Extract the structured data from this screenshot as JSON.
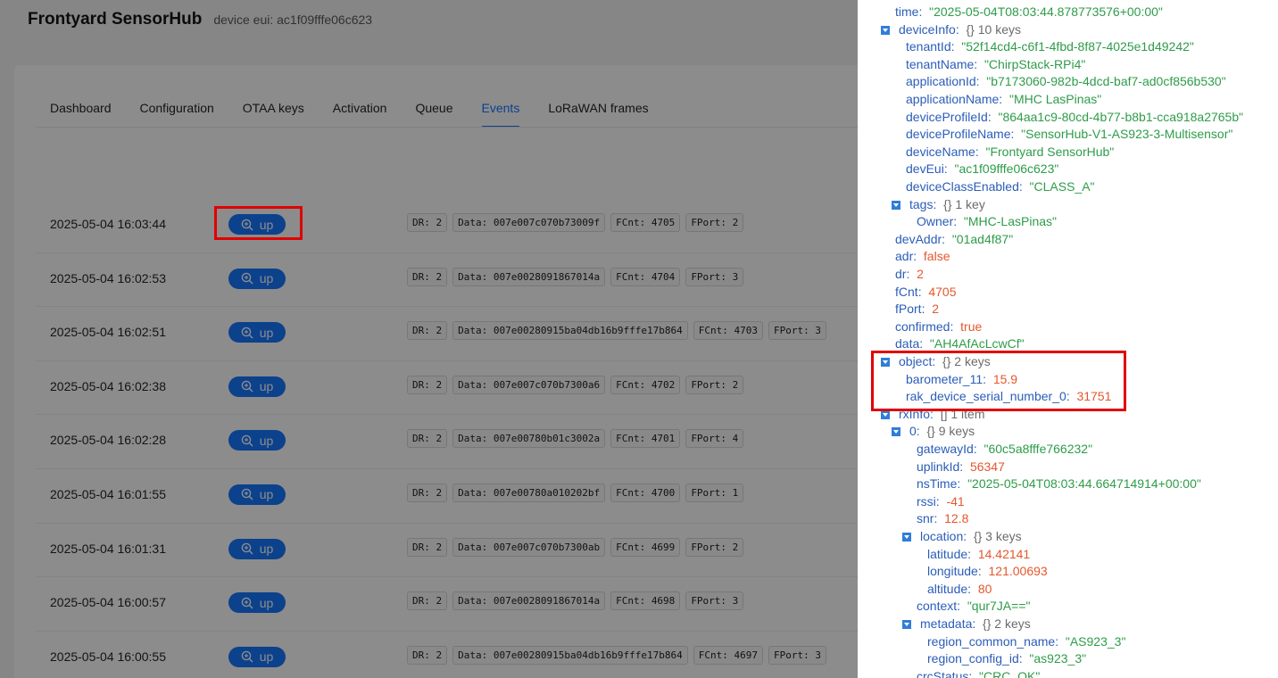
{
  "header": {
    "title": "Frontyard SensorHub",
    "subtitle": "device eui: ac1f09fffe06c623"
  },
  "tabs": [
    {
      "label": "Dashboard"
    },
    {
      "label": "Configuration"
    },
    {
      "label": "OTAA keys"
    },
    {
      "label": "Activation"
    },
    {
      "label": "Queue"
    },
    {
      "label": "Events",
      "active": true
    },
    {
      "label": "LoRaWAN frames"
    }
  ],
  "events": [
    {
      "time": "2025-05-04 16:03:44",
      "type": "up",
      "dr": "DR: 2",
      "data": "Data: 007e007c070b73009f",
      "fcnt": "FCnt: 4705",
      "fport": "FPort: 2"
    },
    {
      "time": "2025-05-04 16:02:53",
      "type": "up",
      "dr": "DR: 2",
      "data": "Data: 007e0028091867014a",
      "fcnt": "FCnt: 4704",
      "fport": "FPort: 3"
    },
    {
      "time": "2025-05-04 16:02:51",
      "type": "up",
      "dr": "DR: 2",
      "data": "Data: 007e00280915ba04db16b9fffe17b864",
      "fcnt": "FCnt: 4703",
      "fport": "FPort: 3"
    },
    {
      "time": "2025-05-04 16:02:38",
      "type": "up",
      "dr": "DR: 2",
      "data": "Data: 007e007c070b7300a6",
      "fcnt": "FCnt: 4702",
      "fport": "FPort: 2"
    },
    {
      "time": "2025-05-04 16:02:28",
      "type": "up",
      "dr": "DR: 2",
      "data": "Data: 007e00780b01c3002a",
      "fcnt": "FCnt: 4701",
      "fport": "FPort: 4"
    },
    {
      "time": "2025-05-04 16:01:55",
      "type": "up",
      "dr": "DR: 2",
      "data": "Data: 007e00780a010202bf",
      "fcnt": "FCnt: 4700",
      "fport": "FPort: 1"
    },
    {
      "time": "2025-05-04 16:01:31",
      "type": "up",
      "dr": "DR: 2",
      "data": "Data: 007e007c070b7300ab",
      "fcnt": "FCnt: 4699",
      "fport": "FPort: 2"
    },
    {
      "time": "2025-05-04 16:00:57",
      "type": "up",
      "dr": "DR: 2",
      "data": "Data: 007e0028091867014a",
      "fcnt": "FCnt: 4698",
      "fport": "FPort: 3"
    },
    {
      "time": "2025-05-04 16:00:55",
      "type": "up",
      "dr": "DR: 2",
      "data": "Data: 007e00280915ba04db16b9fffe17b864",
      "fcnt": "FCnt: 4697",
      "fport": "FPort: 3"
    }
  ],
  "json_tree": [
    {
      "key": "time",
      "value": "\"2025-05-04T08:03:44.878773576+00:00\"",
      "kind": "str",
      "indent": 0,
      "toggle": false
    },
    {
      "key": "deviceInfo",
      "meta": "{}  10 keys",
      "indent": 0,
      "toggle": true
    },
    {
      "key": "tenantId",
      "value": "\"52f14cd4-c6f1-4fbd-8f87-4025e1d49242\"",
      "kind": "str",
      "indent": 1
    },
    {
      "key": "tenantName",
      "value": "\"ChirpStack-RPi4\"",
      "kind": "str",
      "indent": 1
    },
    {
      "key": "applicationId",
      "value": "\"b7173060-982b-4dcd-baf7-ad0cf856b530\"",
      "kind": "str",
      "indent": 1
    },
    {
      "key": "applicationName",
      "value": "\"MHC LasPinas\"",
      "kind": "str",
      "indent": 1
    },
    {
      "key": "deviceProfileId",
      "value": "\"864aa1c9-80cd-4b77-b8b1-cca918a2765b\"",
      "kind": "str",
      "indent": 1
    },
    {
      "key": "deviceProfileName",
      "value": "\"SensorHub-V1-AS923-3-Multisensor\"",
      "kind": "str",
      "indent": 1
    },
    {
      "key": "deviceName",
      "value": "\"Frontyard SensorHub\"",
      "kind": "str",
      "indent": 1
    },
    {
      "key": "devEui",
      "value": "\"ac1f09fffe06c623\"",
      "kind": "str",
      "indent": 1
    },
    {
      "key": "deviceClassEnabled",
      "value": "\"CLASS_A\"",
      "kind": "str",
      "indent": 1
    },
    {
      "key": "tags",
      "meta": "{}  1 key",
      "indent": 1,
      "toggle": true
    },
    {
      "key": "Owner",
      "value": "\"MHC-LasPinas\"",
      "kind": "str",
      "indent": 2
    },
    {
      "key": "devAddr",
      "value": "\"01ad4f87\"",
      "kind": "str",
      "indent": 0
    },
    {
      "key": "adr",
      "value": "false",
      "kind": "bool",
      "indent": 0
    },
    {
      "key": "dr",
      "value": "2",
      "kind": "num",
      "indent": 0
    },
    {
      "key": "fCnt",
      "value": "4705",
      "kind": "num",
      "indent": 0
    },
    {
      "key": "fPort",
      "value": "2",
      "kind": "num",
      "indent": 0
    },
    {
      "key": "confirmed",
      "value": "true",
      "kind": "bool",
      "indent": 0
    },
    {
      "key": "data",
      "value": "\"AH4AfAcLcwCf\"",
      "kind": "str",
      "indent": 0
    },
    {
      "key": "object",
      "meta": "{}  2 keys",
      "indent": 0,
      "toggle": true
    },
    {
      "key": "barometer_11",
      "value": "15.9",
      "kind": "num",
      "indent": 1
    },
    {
      "key": "rak_device_serial_number_0",
      "value": "31751",
      "kind": "num",
      "indent": 1
    },
    {
      "key": "rxInfo",
      "meta": "[]  1 item",
      "indent": 0,
      "toggle": true
    },
    {
      "key": "0",
      "meta": "{}  9 keys",
      "indent": 1,
      "toggle": true
    },
    {
      "key": "gatewayId",
      "value": "\"60c5a8fffe766232\"",
      "kind": "str",
      "indent": 2
    },
    {
      "key": "uplinkId",
      "value": "56347",
      "kind": "num",
      "indent": 2
    },
    {
      "key": "nsTime",
      "value": "\"2025-05-04T08:03:44.664714914+00:00\"",
      "kind": "str",
      "indent": 2
    },
    {
      "key": "rssi",
      "value": "-41",
      "kind": "num",
      "indent": 2
    },
    {
      "key": "snr",
      "value": "12.8",
      "kind": "num",
      "indent": 2
    },
    {
      "key": "location",
      "meta": "{}  3 keys",
      "indent": 2,
      "toggle": true
    },
    {
      "key": "latitude",
      "value": "14.42141",
      "kind": "num",
      "indent": 3
    },
    {
      "key": "longitude",
      "value": "121.00693",
      "kind": "num",
      "indent": 3
    },
    {
      "key": "altitude",
      "value": "80",
      "kind": "num",
      "indent": 3
    },
    {
      "key": "context",
      "value": "\"qur7JA==\"",
      "kind": "str",
      "indent": 2
    },
    {
      "key": "metadata",
      "meta": "{}  2 keys",
      "indent": 2,
      "toggle": true
    },
    {
      "key": "region_common_name",
      "value": "\"AS923_3\"",
      "kind": "str",
      "indent": 3
    },
    {
      "key": "region_config_id",
      "value": "\"as923_3\"",
      "kind": "str",
      "indent": 3
    },
    {
      "key": "crcStatus",
      "value": "\"CRC_OK\"",
      "kind": "str",
      "indent": 2
    }
  ],
  "colors": {
    "accent": "#1677ff",
    "highlight": "#e00000",
    "string": "#2e9c49",
    "number": "#e4572e",
    "key": "#2b5db8"
  }
}
